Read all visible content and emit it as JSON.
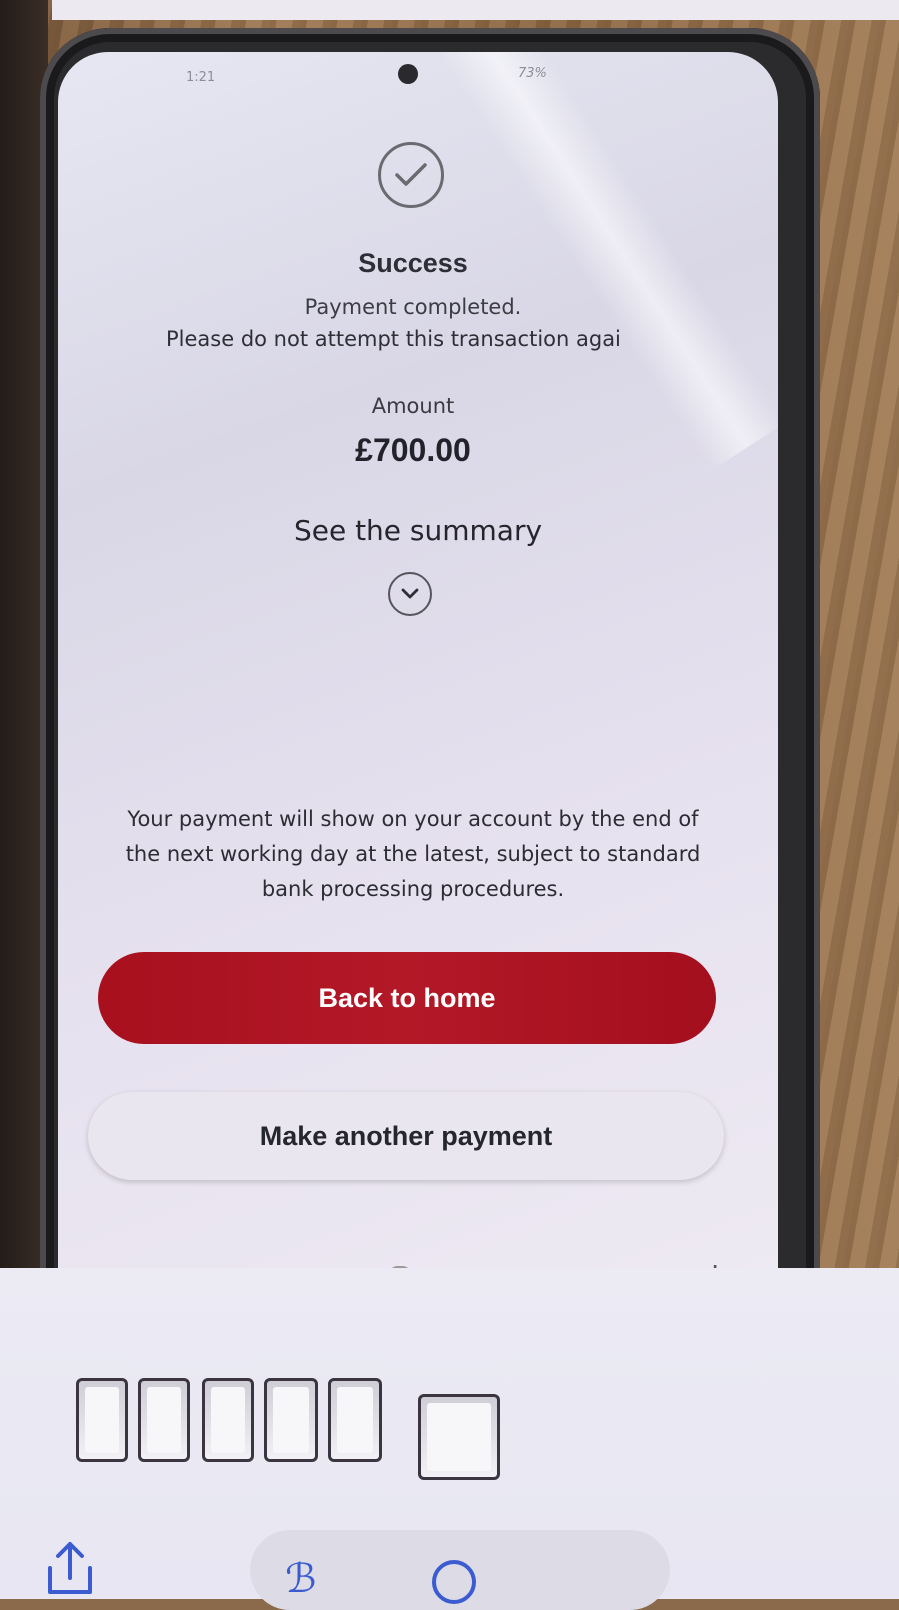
{
  "status_bar": {
    "time": "1:21",
    "battery": "73%"
  },
  "result": {
    "title": "Success",
    "message_line1": "Payment completed.",
    "message_line2": "Please do not attempt this transaction agai"
  },
  "amount": {
    "label": "Amount",
    "value": "£700.00"
  },
  "summary": {
    "label": "See the summary"
  },
  "info_text": "Your payment will show on your account by the end of the next working day at the latest, subject to standard bank processing procedures.",
  "buttons": {
    "primary_label": "Back to home",
    "secondary_label": "Make another payment"
  },
  "colors": {
    "primary": "#b31827",
    "screen_bg": "#e6e7f2"
  },
  "icons": {
    "success": "check-circle-icon",
    "expand": "chevron-down-icon",
    "share": "share-icon"
  }
}
